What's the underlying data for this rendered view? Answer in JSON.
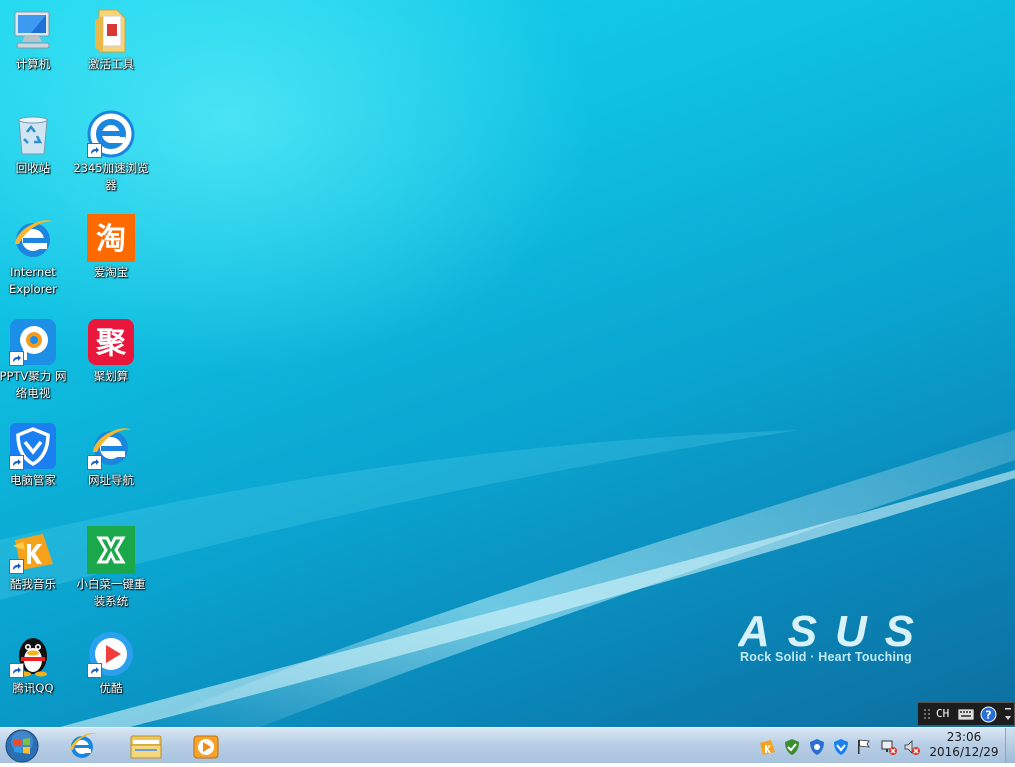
{
  "desktop": {
    "icons": [
      {
        "label": "计算机"
      },
      {
        "label": "激活工具"
      },
      {
        "label": "回收站"
      },
      {
        "label": "2345加速浏览器"
      },
      {
        "label": "Internet Explorer"
      },
      {
        "label": "爱淘宝"
      },
      {
        "label": "PPTV聚力 网络电视"
      },
      {
        "label": "聚划算"
      },
      {
        "label": "电脑管家"
      },
      {
        "label": "网址导航"
      },
      {
        "label": "酷我音乐"
      },
      {
        "label": "小白菜一键重装系统"
      },
      {
        "label": "腾讯QQ"
      },
      {
        "label": "优酷"
      }
    ],
    "taobao_glyph": "淘",
    "juhuasuan_glyph": "聚"
  },
  "wallpaper": {
    "brand": "ASUS",
    "tagline": "Rock Solid · Heart Touching"
  },
  "language_bar": {
    "language": "CH"
  },
  "taskbar": {
    "clock": {
      "time": "23:06",
      "date": "2016/12/29"
    }
  },
  "colors": {
    "taskbar": "#b9cfe6",
    "desktop": "#0fc0e2"
  }
}
